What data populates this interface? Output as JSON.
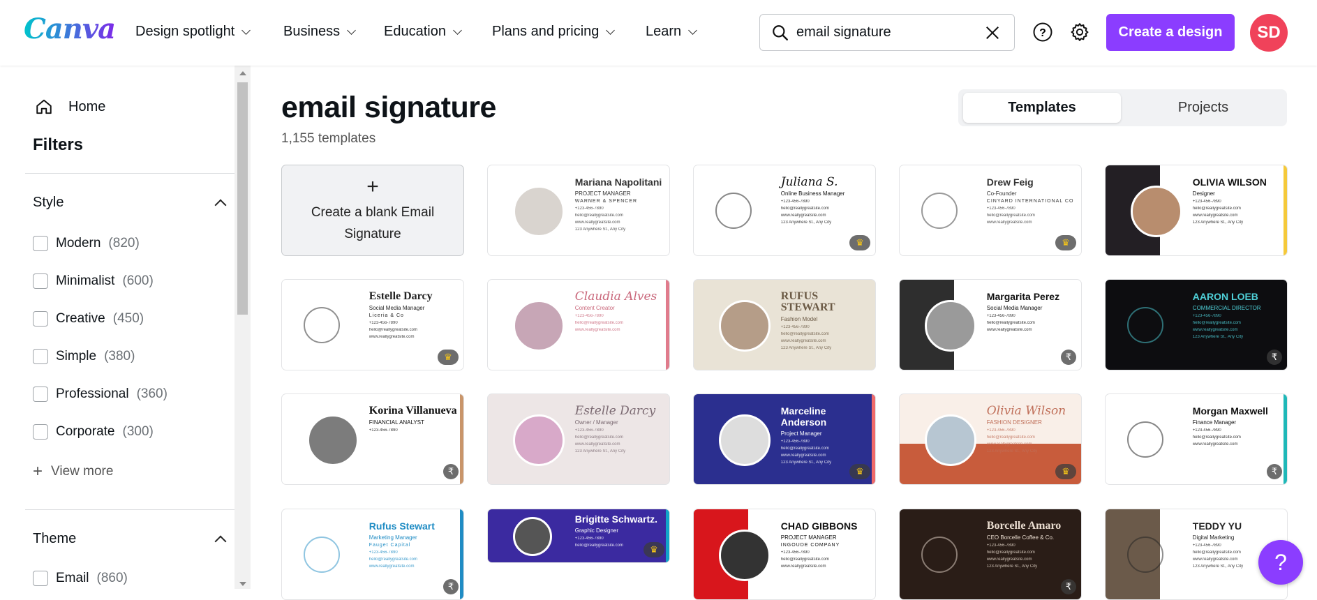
{
  "header": {
    "logo": "Canva",
    "nav": [
      "Design spotlight",
      "Business",
      "Education",
      "Plans and pricing",
      "Learn"
    ],
    "search_value": "email signature",
    "create_label": "Create a design",
    "avatar_initials": "SD",
    "brand_color": "#8b3dff",
    "avatar_color": "#f0425a"
  },
  "sidebar": {
    "home": "Home",
    "filters": "Filters",
    "style_heading": "Style",
    "style_options": [
      {
        "label": "Modern",
        "count": "(820)"
      },
      {
        "label": "Minimalist",
        "count": "(600)"
      },
      {
        "label": "Creative",
        "count": "(450)"
      },
      {
        "label": "Simple",
        "count": "(380)"
      },
      {
        "label": "Professional",
        "count": "(360)"
      },
      {
        "label": "Corporate",
        "count": "(300)"
      }
    ],
    "view_more": "View more",
    "theme_heading": "Theme",
    "theme_options": [
      {
        "label": "Email",
        "count": "(860)"
      }
    ]
  },
  "main": {
    "title": "email signature",
    "count": "1,155 templates",
    "tabs": [
      "Templates",
      "Projects"
    ],
    "blank_label": "Create a blank Email Signature",
    "templates": [
      {
        "name": "Mariana Napolitani",
        "role": "PROJECT MANAGER",
        "extra": "WARNER & SPENCER",
        "font": "sans",
        "bg": "#ffffff",
        "fg": "#333333",
        "photo": "#d9d4cf",
        "badge": null,
        "lines": 4
      },
      {
        "name": "Juliana S.",
        "role": "Online Business Manager",
        "extra": "",
        "font": "script",
        "bg": "#ffffff",
        "fg": "#111111",
        "photo": null,
        "badge": "crown",
        "lines": 4
      },
      {
        "name": "Drew Feig",
        "role": "Co-Founder",
        "extra": "CINYARD INTERNATIONAL CO",
        "font": "sans",
        "bg": "#ffffff",
        "fg": "#333333",
        "photo": null,
        "badge": "crown",
        "lines": 3
      },
      {
        "name": "OLIVIA WILSON",
        "role": "Designer",
        "extra": "",
        "font": "sans",
        "bg": "#ffffff",
        "fg": "#111111",
        "panel": "#231f24",
        "accent": "#f5c93a",
        "photo": "#b88d6e",
        "badge": null,
        "lines": 4
      },
      {
        "name": "Estelle Darcy",
        "role": "Social Media Manager",
        "extra": "Liceria & Co",
        "font": "serif",
        "bg": "#ffffff",
        "fg": "#222222",
        "photo": null,
        "badge": "crown",
        "lines": 3
      },
      {
        "name": "Claudia Alves",
        "role": "Content Creator",
        "extra": "",
        "font": "script",
        "bg": "#ffffff",
        "fg": "#c9667a",
        "accent": "#e07b8c",
        "photo": "#c7a6b6",
        "badge": null,
        "lines": 3
      },
      {
        "name": "RUFUS STEWART",
        "role": "Fashion Model",
        "extra": "",
        "font": "serif",
        "bg": "#e9e3d6",
        "fg": "#6b5a45",
        "photo": "#b59d88",
        "badge": null,
        "lines": 4
      },
      {
        "name": "Margarita Perez",
        "role": "Social Media Manager",
        "extra": "",
        "font": "sans",
        "bg": "#ffffff",
        "fg": "#111111",
        "panel": "#2e2e2e",
        "photo": "#9a9a9a",
        "badge": "rupee",
        "lines": 3
      },
      {
        "name": "AARON LOEB",
        "role": "COMMERCIAL DIRECTOR",
        "extra": "",
        "font": "sans",
        "bg": "#0d0d10",
        "fg": "#4fd1d9",
        "photo": null,
        "badge": "rupee",
        "lines": 4
      },
      {
        "name": "Korina Villanueva",
        "role": "FINANCIAL ANALYST",
        "extra": "",
        "font": "serif",
        "bg": "#ffffff",
        "fg": "#111111",
        "accent": "#c9956a",
        "photo": "#7c7c7c",
        "badge": "rupee",
        "lines": 1
      },
      {
        "name": "Estelle Darcy",
        "role": "Owner / Manager",
        "extra": "",
        "font": "script",
        "bg": "#ede6e6",
        "fg": "#7b6a72",
        "photo": "#d8a9c9",
        "badge": null,
        "lines": 4
      },
      {
        "name": "Marceline Anderson",
        "role": "Project Manager",
        "extra": "",
        "font": "sans",
        "bg": "#2b2f8f",
        "fg": "#ffffff",
        "accent": "#f06a6a",
        "photo": "#dddddd",
        "badge": "crown",
        "lines": 4
      },
      {
        "name": "Olivia Wilson",
        "role": "FASHION DESIGNER",
        "extra": "",
        "font": "script",
        "bg": "#f9efe8",
        "fg": "#c0705a",
        "panel2": "#c85c3c",
        "photo": "#b7c6d2",
        "badge": "crown",
        "lines": 4
      },
      {
        "name": "Morgan Maxwell",
        "role": "Finance Manager",
        "extra": "",
        "font": "sans",
        "bg": "#ffffff",
        "fg": "#111111",
        "accent": "#1fb8b8",
        "photo": null,
        "badge": "rupee",
        "lines": 3
      },
      {
        "name": "Rufus Stewart",
        "role": "Marketing Manager",
        "extra": "Fauget Capital",
        "font": "sans",
        "bg": "#ffffff",
        "fg": "#1f8cc4",
        "accent": "#1f8cc4",
        "photo": null,
        "badge": "rupee",
        "lines": 3
      },
      {
        "name": "Brigitte Schwartz.",
        "role": "Graphic Designer",
        "extra": "",
        "font": "sans",
        "bg": "#3b2aa0",
        "fg": "#ffffff",
        "accent": "#11a4c8",
        "photo": "#555555",
        "badge": "crown",
        "lines": 4
      },
      {
        "name": "CHAD GIBBONS",
        "role": "PROJECT MANAGER",
        "extra": "INGOUDE COMPANY",
        "font": "sans",
        "bg": "#ffffff",
        "fg": "#111111",
        "panel": "#d8161c",
        "photo": "#333333",
        "badge": null,
        "lines": 3
      },
      {
        "name": "Borcelle Amaro",
        "role": "CEO Borcelle Coffee & Co.",
        "extra": "",
        "font": "serif",
        "bg": "#2a1d17",
        "fg": "#e9dccf",
        "photo": null,
        "badge": "rupee",
        "lines": 4
      },
      {
        "name": "TEDDY YU",
        "role": "Digital Marketing",
        "extra": "",
        "font": "sans",
        "bg": "#ffffff",
        "fg": "#222222",
        "panel": "#6b5a4a",
        "photo": null,
        "badge": null,
        "lines": 4
      }
    ],
    "contacts": [
      "+123-456-7890",
      "hello@reallygreatsite.com",
      "www.reallygreatsite.com",
      "123 Anywhere St., Any City"
    ]
  },
  "help_button": "?"
}
